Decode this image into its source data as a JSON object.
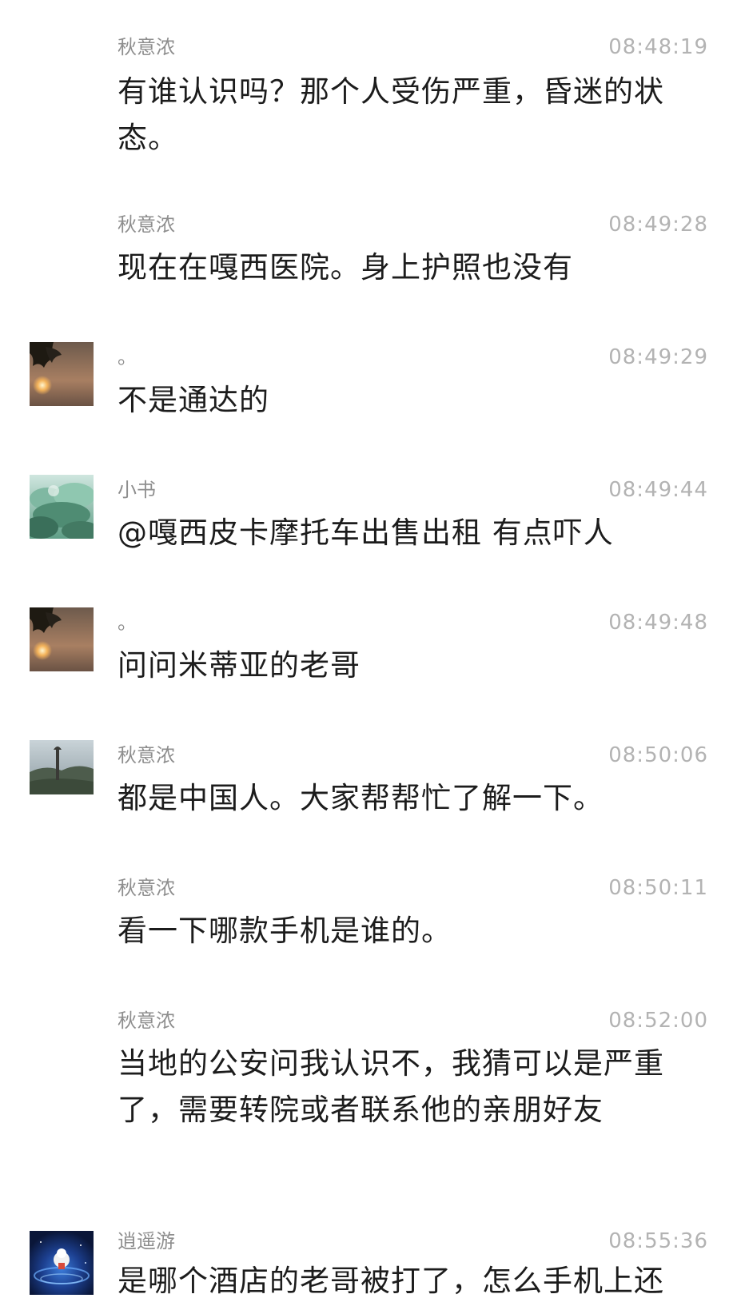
{
  "messages": [
    {
      "sender": "秋意浓",
      "time": "08:48:19",
      "text": "有谁认识吗？那个人受伤严重，昏迷的状态。",
      "avatar": null
    },
    {
      "sender": "秋意浓",
      "time": "08:49:28",
      "text": "现在在嘎西医院。身上护照也没有",
      "avatar": null
    },
    {
      "sender": "。",
      "time": "08:49:29",
      "text": "不是通达的",
      "avatar": "sunset-avatar"
    },
    {
      "sender": "小书",
      "time": "08:49:44",
      "text": "@嘎西皮卡摩托车出售出租 有点吓人",
      "avatar": "forest-avatar"
    },
    {
      "sender": "。",
      "time": "08:49:48",
      "text": "问问米蒂亚的老哥",
      "avatar": "sunset-avatar"
    },
    {
      "sender": "秋意浓",
      "time": "08:50:06",
      "text": "都是中国人。大家帮帮忙了解一下。",
      "avatar": "landscape-avatar"
    },
    {
      "sender": "秋意浓",
      "time": "08:50:11",
      "text": "看一下哪款手机是谁的。",
      "avatar": null
    },
    {
      "sender": "秋意浓",
      "time": "08:52:00",
      "text": "当地的公安问我认识不，我猜可以是严重了，需要转院或者联系他的亲朋好友",
      "avatar": null
    },
    {
      "sender": "逍遥游",
      "time": "08:55:36",
      "text": "是哪个酒店的老哥被打了，怎么手机上还",
      "avatar": "galaxy-avatar"
    }
  ]
}
